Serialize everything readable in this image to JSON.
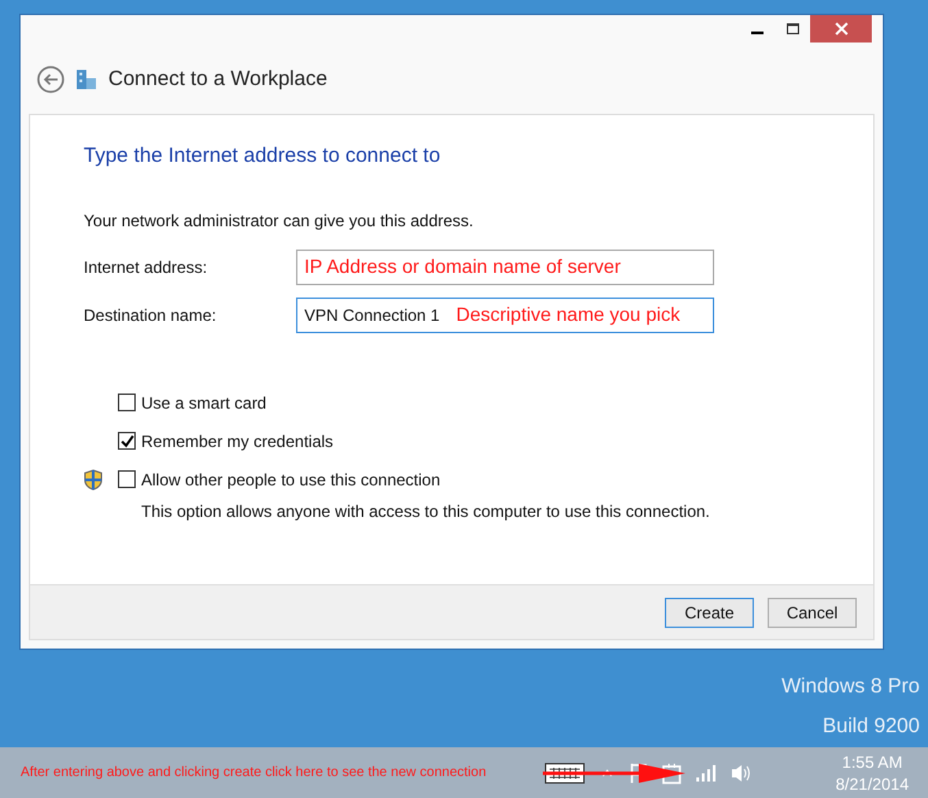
{
  "window": {
    "title": "Connect to a Workplace"
  },
  "heading": "Type the Internet address to connect to",
  "intro": "Your network administrator can give you this address.",
  "fields": [
    {
      "label": "Internet address:",
      "annotation": "IP Address or domain name of server",
      "focused": false
    },
    {
      "label": "Destination name:",
      "value": "VPN Connection 1",
      "annotation": "Descriptive name you pick",
      "focused": true
    }
  ],
  "options": [
    {
      "label": "Use a smart card",
      "checked": false,
      "shield": false
    },
    {
      "label": "Remember my credentials",
      "checked": true,
      "shield": false
    },
    {
      "label": "Allow other people to use this connection",
      "checked": false,
      "shield": true,
      "note": "This option allows anyone with access to this computer to use this connection."
    }
  ],
  "buttons": [
    {
      "label": "Create",
      "default": true
    },
    {
      "label": "Cancel",
      "default": false
    }
  ],
  "desktop": {
    "edition": "Windows 8 Pro",
    "build": "Build 9200"
  },
  "taskbar": {
    "annotation": "After entering above and clicking create click here to see the new connection",
    "time": "1:55 AM",
    "date": "8/21/2014"
  }
}
